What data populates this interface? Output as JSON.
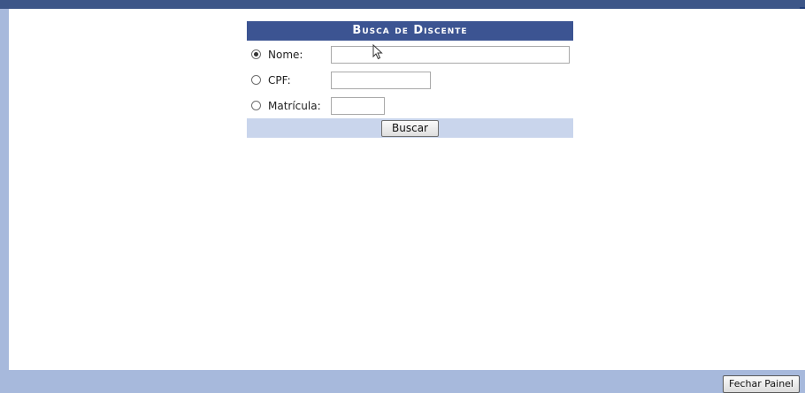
{
  "search_form": {
    "title": "Busca de Discente",
    "fields": [
      {
        "label": "Nome:",
        "value": "",
        "checked": true
      },
      {
        "label": "CPF:",
        "value": "",
        "checked": false
      },
      {
        "label": "Matrícula:",
        "value": "",
        "checked": false
      }
    ],
    "submit_label": "Buscar"
  },
  "panel": {
    "close_label": "Fechar Painel"
  },
  "colors": {
    "header_bg": "#3c5492",
    "footer_bg": "#c9d5ec",
    "frame_bg": "#a7b9dc"
  },
  "icons": {
    "cursor": "mouse-pointer-icon"
  }
}
